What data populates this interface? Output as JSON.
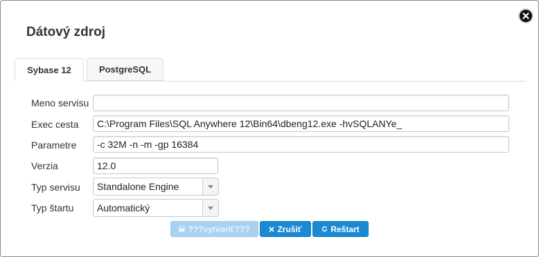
{
  "dialog": {
    "title": "Dátový zdroj"
  },
  "tabs": [
    {
      "label": "Sybase 12",
      "active": true
    },
    {
      "label": "PostgreSQL",
      "active": false
    }
  ],
  "form": {
    "service_name": {
      "label": "Meno servisu",
      "value": ""
    },
    "exec_path": {
      "label": "Exec cesta",
      "value": "C:\\Program Files\\SQL Anywhere 12\\Bin64\\dbeng12.exe -hvSQLANYe_"
    },
    "parameters": {
      "label": "Parametre",
      "value": "-c 32M -n -m -gp 16384"
    },
    "version": {
      "label": "Verzia",
      "value": "12.0"
    },
    "service_type": {
      "label": "Typ servisu",
      "value": "Standalone Engine"
    },
    "start_type": {
      "label": "Typ štartu",
      "value": "Automatický"
    }
  },
  "buttons": {
    "create": "???vytvoriť???",
    "cancel": "Zrušiť",
    "restart": "Reštart"
  },
  "icons": {
    "close": "close-icon",
    "create": "save-icon",
    "cancel": "x-icon",
    "restart": "refresh-icon",
    "select_arrow": "chevron-down-icon"
  },
  "colors": {
    "primary": "#1a8ad4",
    "disabled": "#a9d2f0"
  }
}
